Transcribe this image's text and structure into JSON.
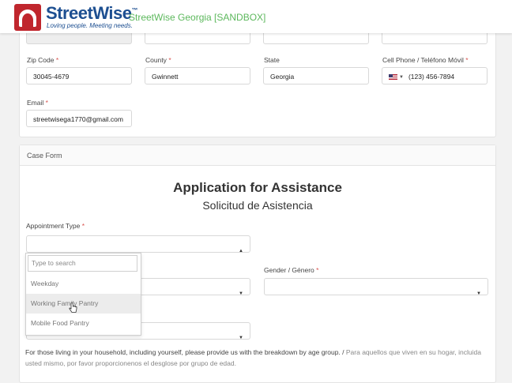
{
  "header": {
    "brand": "StreetWise",
    "tagline": "Loving people. Meeting needs.",
    "environment": "StreetWise Georgia [SANDBOX]"
  },
  "contact": {
    "zip": {
      "label": "Zip Code",
      "value": "30045-4679"
    },
    "county": {
      "label": "County",
      "value": "Gwinnett"
    },
    "state": {
      "label": "State",
      "value": "Georgia"
    },
    "phone": {
      "label": "Cell Phone / Teléfono Móvil",
      "value": "(123) 456-7894"
    },
    "email": {
      "label": "Email",
      "value": "streetwisega1770@gmail.com"
    }
  },
  "case_form": {
    "section_title": "Case Form",
    "title_en": "Application for Assistance",
    "title_es": "Solicitud de Asistencia",
    "appointment_label": "Appointment Type",
    "gender_label": "Gender / Género",
    "dropdown": {
      "placeholder": "Type to search",
      "options": [
        "Weekday",
        "Working Family Pantry",
        "Mobile Food Pantry"
      ],
      "hovered_index": 1
    },
    "help_en": "For those living in your household, including yourself, please provide us with the breakdown by age group.",
    "help_es": "Para aquellos que viven en su hogar, incluida usted mismo, por favor proporcionenos el desglose por grupo de edad."
  },
  "colors": {
    "brand": "#1d4f91",
    "logo_red": "#c0262d",
    "sandbox_green": "#5cb85c",
    "required": "#d9534f"
  }
}
